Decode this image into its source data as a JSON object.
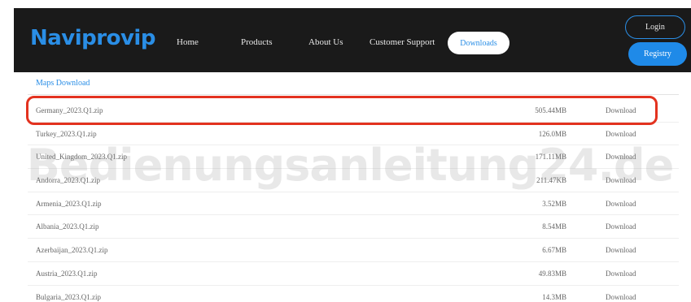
{
  "header": {
    "logo": "Naviprovip",
    "nav": [
      "Home",
      "Products",
      "About Us",
      "Customer Support"
    ],
    "active_nav": "Downloads",
    "login_label": "Login",
    "registry_label": "Registry"
  },
  "section": {
    "title": "Maps Download"
  },
  "files": [
    {
      "name": "Germany_2023.Q1.zip",
      "size": "505.44MB",
      "action": "Download"
    },
    {
      "name": "Turkey_2023.Q1.zip",
      "size": "126.0MB",
      "action": "Download"
    },
    {
      "name": "United_Kingdom_2023.Q1.zip",
      "size": "171.11MB",
      "action": "Download"
    },
    {
      "name": "Andorra_2023.Q1.zip",
      "size": "211.47KB",
      "action": "Download"
    },
    {
      "name": "Armenia_2023.Q1.zip",
      "size": "3.52MB",
      "action": "Download"
    },
    {
      "name": "Albania_2023.Q1.zip",
      "size": "8.54MB",
      "action": "Download"
    },
    {
      "name": "Azerbaijan_2023.Q1.zip",
      "size": "6.67MB",
      "action": "Download"
    },
    {
      "name": "Austria_2023.Q1.zip",
      "size": "49.83MB",
      "action": "Download"
    },
    {
      "name": "Bulgaria_2023.Q1.zip",
      "size": "14.3MB",
      "action": "Download"
    }
  ],
  "watermark": "Bedienungsanleitung24.de",
  "colors": {
    "accent": "#2a8ee6",
    "navbar": "#1a1a1a",
    "highlight": "#e3321f"
  }
}
